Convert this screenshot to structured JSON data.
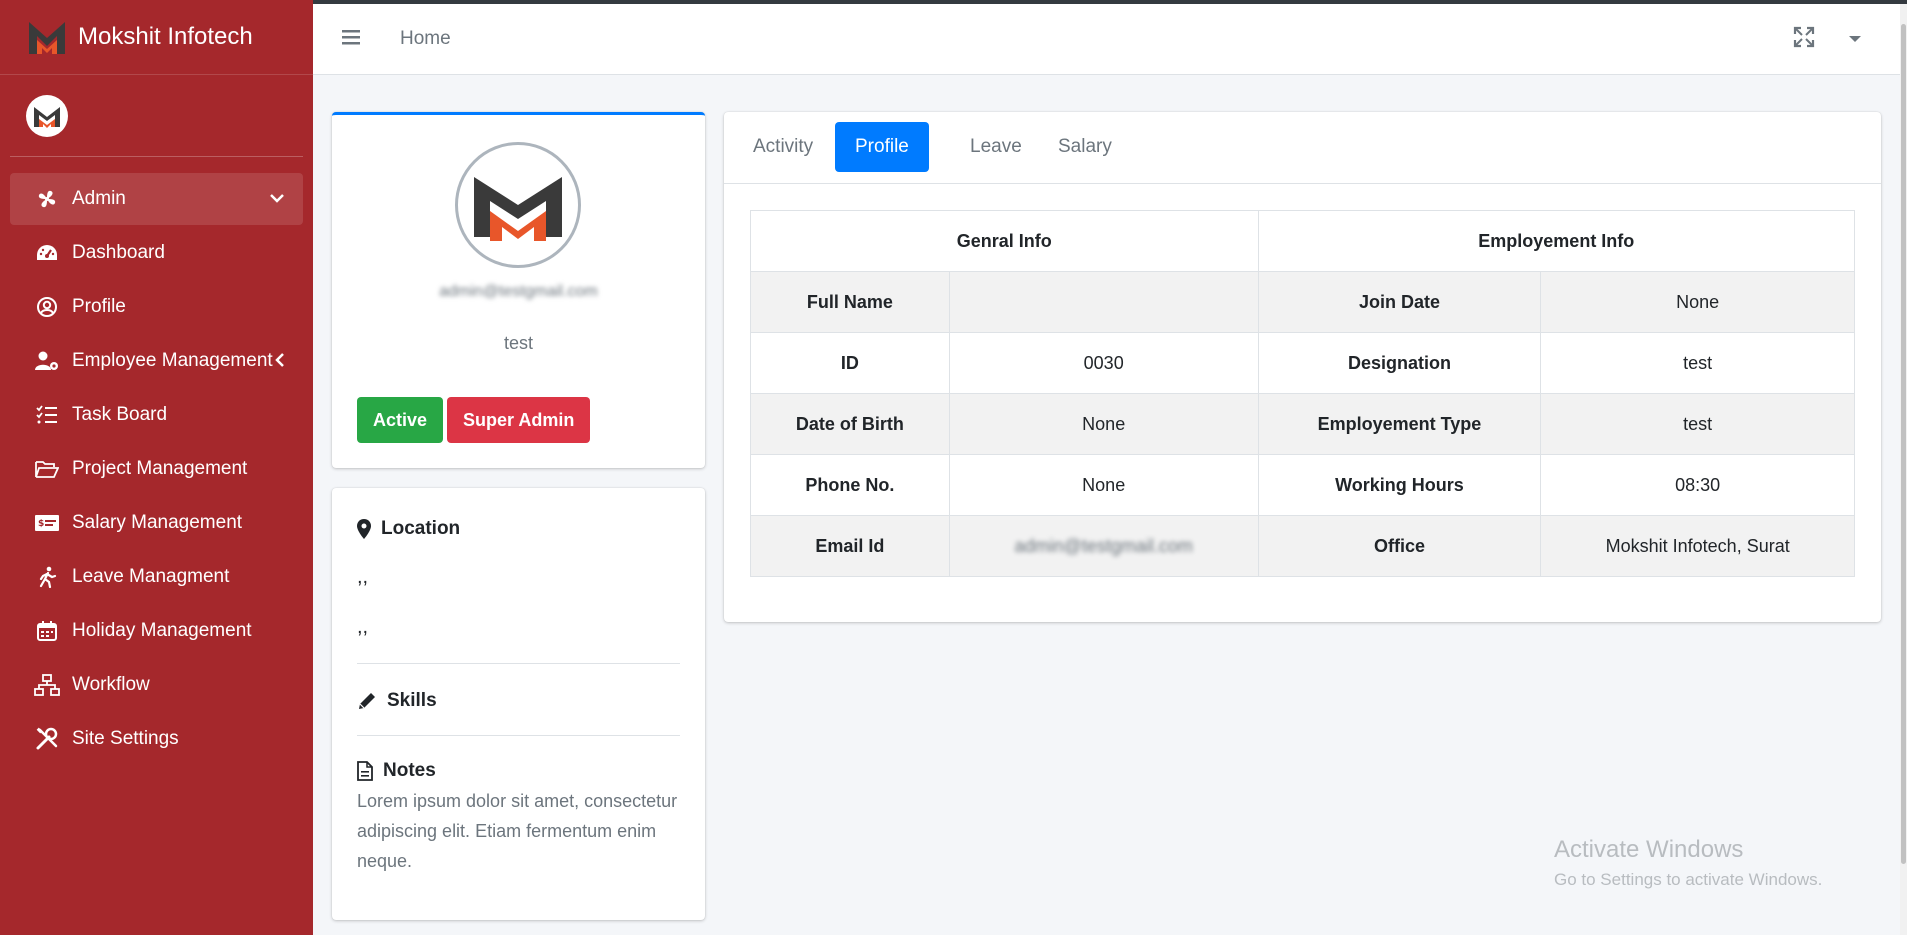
{
  "brand": {
    "name": "Mokshit Infotech"
  },
  "sidebar": {
    "items": [
      {
        "label": "Admin",
        "icon": "fan-icon"
      },
      {
        "label": "Dashboard",
        "icon": "gauge-icon"
      },
      {
        "label": "Profile",
        "icon": "user-circle-icon"
      },
      {
        "label": "Employee Management",
        "icon": "user-gear-icon"
      },
      {
        "label": "Task Board",
        "icon": "tasks-icon"
      },
      {
        "label": "Project Management",
        "icon": "folder-open-icon"
      },
      {
        "label": "Salary Management",
        "icon": "money-bill-icon"
      },
      {
        "label": "Leave Managment",
        "icon": "walking-icon"
      },
      {
        "label": "Holiday Management",
        "icon": "calendar-icon"
      },
      {
        "label": "Workflow",
        "icon": "sitemap-icon"
      },
      {
        "label": "Site Settings",
        "icon": "tools-icon"
      }
    ]
  },
  "header": {
    "home": "Home"
  },
  "profile": {
    "email": "admin@testgmail.com",
    "name": "test",
    "status_badge": "Active",
    "role_badge": "Super Admin"
  },
  "about": {
    "location_title": "Location",
    "location_line1": ",,",
    "location_line2": ",,",
    "skills_title": "Skills",
    "notes_title": "Notes",
    "notes_text": "Lorem ipsum dolor sit amet, consectetur adipiscing elit. Etiam fermentum enim neque."
  },
  "tabs": [
    "Activity",
    "Profile",
    "Leave",
    "Salary"
  ],
  "info_table": {
    "general_header": "Genral Info",
    "employment_header": "Employement Info",
    "rows": [
      {
        "g_label": "Full Name",
        "g_value": "",
        "e_label": "Join Date",
        "e_value": "None"
      },
      {
        "g_label": "ID",
        "g_value": "0030",
        "e_label": "Designation",
        "e_value": "test"
      },
      {
        "g_label": "Date of Birth",
        "g_value": "None",
        "e_label": "Employement Type",
        "e_value": "test"
      },
      {
        "g_label": "Phone No.",
        "g_value": "None",
        "e_label": "Working Hours",
        "e_value": "08:30"
      },
      {
        "g_label": "Email Id",
        "g_value": "admin@testgmail.com",
        "e_label": "Office",
        "e_value": "Mokshit Infotech, Surat"
      }
    ]
  },
  "watermark": {
    "line1": "Activate Windows",
    "line2": "Go to Settings to activate Windows."
  },
  "colors": {
    "sidebar": "#a5282c",
    "primary": "#007bff",
    "success": "#28a745",
    "danger": "#dc3545",
    "logo_orange": "#e8562a",
    "logo_dark": "#3a3a3a"
  }
}
